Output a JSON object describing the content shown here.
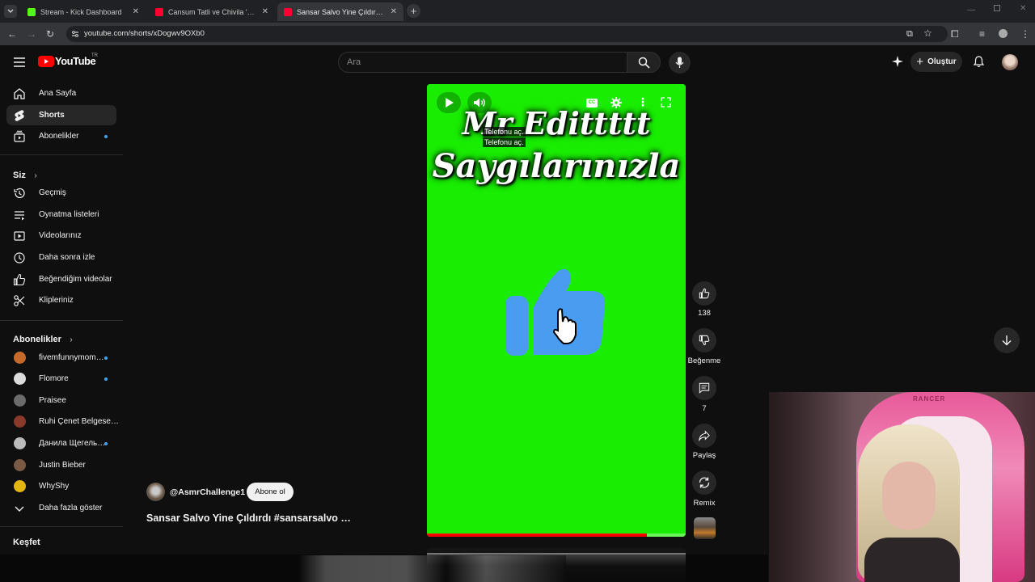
{
  "browser": {
    "tabs": [
      {
        "title": "Stream - Kick Dashboard",
        "favicon_color": "#53fc18",
        "active": false
      },
      {
        "title": "Cansum Tatli ve Chivila 'nın tanı…",
        "favicon_color": "#ff0033",
        "active": false
      },
      {
        "title": "Sansar Salvo Yine Çıldırdı #sansa…",
        "favicon_color": "#ff0033",
        "active": true
      }
    ],
    "url": "youtube.com/shorts/xDogwv9OXb0"
  },
  "header": {
    "logo_text": "YouTube",
    "region": "TR",
    "search_placeholder": "Ara",
    "create_label": "Oluştur"
  },
  "sidebar": {
    "main": [
      {
        "label": "Ana Sayfa",
        "icon": "home-icon"
      },
      {
        "label": "Shorts",
        "icon": "shorts-icon",
        "active": true
      },
      {
        "label": "Abonelikler",
        "icon": "subscriptions-icon",
        "dot": true
      }
    ],
    "you_heading": "Siz",
    "you": [
      {
        "label": "Geçmiş",
        "icon": "history-icon"
      },
      {
        "label": "Oynatma listeleri",
        "icon": "playlists-icon"
      },
      {
        "label": "Videolarınız",
        "icon": "your-videos-icon"
      },
      {
        "label": "Daha sonra izle",
        "icon": "watch-later-icon"
      },
      {
        "label": "Beğendiğim videolar",
        "icon": "liked-videos-icon"
      },
      {
        "label": "Klipleriniz",
        "icon": "clips-icon"
      }
    ],
    "subs_heading": "Abonelikler",
    "subs": [
      {
        "label": "fivemfunnymom…",
        "color": "#c56a2b",
        "dot": true
      },
      {
        "label": "Flomore",
        "color": "#dcdcdc",
        "dot": true
      },
      {
        "label": "Praisee",
        "color": "#6b6b6b",
        "dot": false
      },
      {
        "label": "Ruhi Çenet Belgese…",
        "color": "#8a3a2a",
        "dot": false
      },
      {
        "label": "Данила Щегель…",
        "color": "#bbbbbb",
        "dot": true
      },
      {
        "label": "Justin Bieber",
        "color": "#7a5a44",
        "dot": false
      },
      {
        "label": "WhyShy",
        "color": "#e3b70e",
        "dot": false
      }
    ],
    "show_more": "Daha fazla göster",
    "explore_heading": "Keşfet"
  },
  "video": {
    "title_line1": "Mr Edittttt",
    "title_line2": "Saygılarınızla",
    "tooltip1": "Telefonu aç.",
    "tooltip2": "Telefonu aç.",
    "background": "#19ee02",
    "like_color": "#4a9cf0",
    "progress": 0.85
  },
  "actions": {
    "like_count": "138",
    "dislike_label": "Beğenme",
    "comment_count": "7",
    "share_label": "Paylaş",
    "remix_label": "Remix"
  },
  "channel": {
    "handle": "@AsmrChallenge1",
    "subscribe_label": "Abone ol"
  },
  "short_title": "Sansar Salvo Yine Çıldırdı #sansarsalvo …",
  "webcam": {
    "chair_brand": "RANCER"
  }
}
